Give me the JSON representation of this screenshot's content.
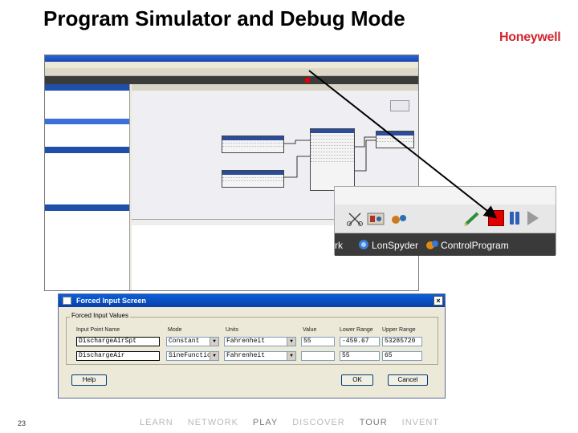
{
  "slide": {
    "title": "Program Simulator and Debug Mode",
    "brand": "Honeywell",
    "page_number": "23",
    "footer_nav": [
      "LEARN",
      "NETWORK",
      "PLAY",
      "DISCOVER",
      "TOUR",
      "INVENT"
    ]
  },
  "zoom": {
    "tab_lonspyder": "LonSpyder",
    "tab_controlprogram": "ControlProgram",
    "tab_partial": "rk",
    "stop_color": "#e00000",
    "icons": [
      "scissors-icon",
      "graphics-icon",
      "network-icon",
      "pencil-icon",
      "stop-icon",
      "pause-icon",
      "play-icon"
    ]
  },
  "dialog": {
    "title": "Forced Input Screen",
    "close_glyph": "×",
    "group_label": "Forced Input Values",
    "columns": [
      "Input Point Name",
      "Mode",
      "Units",
      "Value",
      "Lower Range",
      "Upper Range"
    ],
    "rows": [
      {
        "name": "DischargeAirSpt",
        "mode": "Constant",
        "units": "Fahrenheit",
        "value": "55",
        "lower": "-459.67",
        "upper": "53285720"
      },
      {
        "name": "DischargeAir",
        "mode": "SineFunction",
        "units": "Fahrenheit",
        "value": "",
        "lower": "55",
        "upper": "65"
      }
    ],
    "help_label": "Help",
    "ok_label": "OK",
    "cancel_label": "Cancel"
  }
}
